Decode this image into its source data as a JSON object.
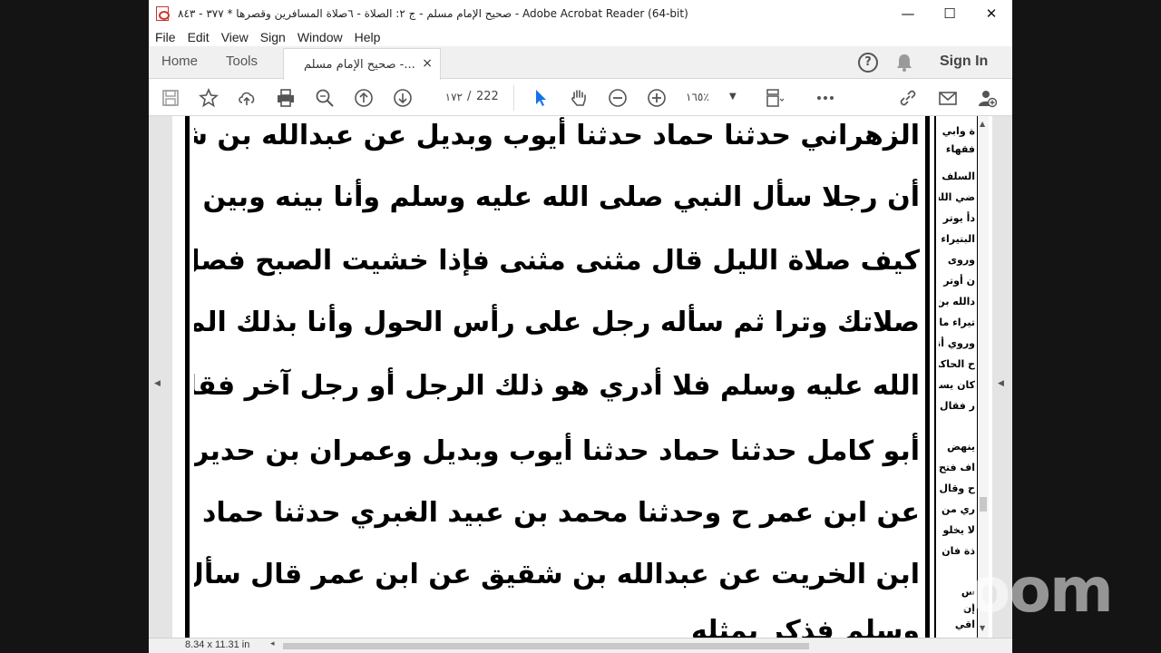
{
  "window": {
    "title": "صحيح الإمام مسلم - ج ٢: الصلاة - ٦صلاة المسافرين وقصرها * ٣٧٧ - ٨٤٣ - Adobe Acrobat Reader (64-bit)",
    "controls": {
      "minimize": "—",
      "maximize": "☐",
      "close": "✕"
    }
  },
  "menu": [
    "File",
    "Edit",
    "View",
    "Sign",
    "Window",
    "Help"
  ],
  "tabs": {
    "home": "Home",
    "tools": "Tools",
    "document": "صحيح الإمام مسلم -...",
    "close": "×"
  },
  "header": {
    "sign_in": "Sign In",
    "help": "?"
  },
  "toolbar": {
    "page_current": "١٧٢",
    "page_separator": "/",
    "page_total": "222",
    "zoom": "١٦٥٪",
    "zoom_dropdown": "▼",
    "icons": [
      "save-icon",
      "bookmark-star-icon",
      "upload-cloud-icon",
      "print-icon",
      "search-zoom-icon",
      "page-up-icon",
      "page-down-icon",
      "select-cursor-icon",
      "hand-tool-icon",
      "zoom-out-icon",
      "zoom-in-icon",
      "page-fit-icon",
      "more-icon",
      "share-link-icon",
      "email-icon",
      "add-user-icon"
    ]
  },
  "document": {
    "lines": [
      "الزهراني حدثنا حماد حدثنا أيوب وبديل عن عبدالله بن شقيق عن عبدالله بن عمر",
      "أن رجلا سأل النبي صلى الله عليه وسلم وأنا بينه وبين السائل فقال يا رسول الله",
      "كيف صلاة الليل قال مثنى مثنى فإذا خشيت الصبح فصل ركعة واجعل آخر",
      "صلاتك وترا ثم سأله رجل على رأس الحول وأنا بذلك المكان من رسول الله صلى",
      "الله عليه وسلم فلا أدري هو ذلك الرجل أو رجل آخر فقال له مثل ذلك وحدثني",
      "أبو كامل حدثنا حماد حدثنا أيوب وبديل وعمران بن حدير عن عبدالله بن شقيق",
      "عن ابن عمر ح وحدثنا محمد بن عبيد الغبري حدثنا حماد حدثنا أيوب والزبير",
      "ابن الخريت عن عبدالله بن شقيق عن ابن عمر قال سأل رجل النبي صلى الله عليه",
      "وسلم فذكر بمثله"
    ],
    "side_lines": [
      "ة وابي",
      "فقهاء",
      "",
      "السلف",
      "ضي الله",
      "دأ يوتر",
      "البتيراء",
      "وروى",
      "ن أوتر",
      "دالله بن",
      "تيراء ما",
      "وروي أنه",
      "ح الحاكم",
      "كان يسلم",
      "ر فقال",
      "",
      "ينهض",
      "اف فتح",
      "ح وقال",
      "ري من",
      "لا يخلو",
      "ذة فان",
      "",
      "س",
      "إن",
      "اقي"
    ]
  },
  "status": {
    "page_size": "8.34 x 11.31 in",
    "scroll_left": "◂"
  },
  "watermark": "zoom"
}
